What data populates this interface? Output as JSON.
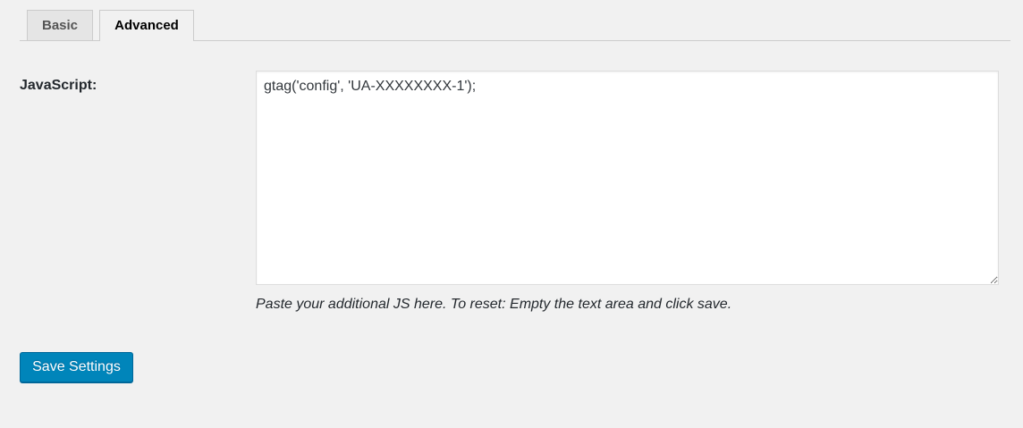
{
  "tabs": {
    "basic": "Basic",
    "advanced": "Advanced"
  },
  "form": {
    "javascript_label": "JavaScript:",
    "javascript_value": "gtag('config', 'UA-XXXXXXXX-1');",
    "description": "Paste your additional JS here. To reset: Empty the text area and click save."
  },
  "actions": {
    "save_label": "Save Settings"
  },
  "colors": {
    "background": "#f1f1f1",
    "primary_button": "#0085ba",
    "inactive_tab": "#e5e5e5"
  }
}
